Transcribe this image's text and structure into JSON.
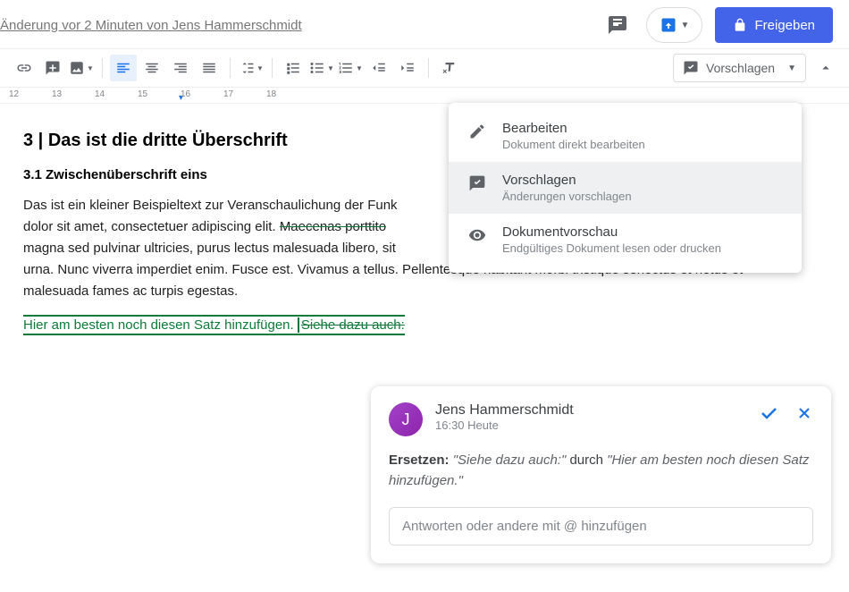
{
  "topbar": {
    "history": "Änderung vor 2 Minuten von Jens Hammerschmidt",
    "share_label": "Freigeben"
  },
  "toolbar": {
    "mode_label": "Vorschlagen"
  },
  "ruler": {
    "ticks": [
      "12",
      "13",
      "14",
      "15",
      "16",
      "17",
      "18"
    ]
  },
  "doc": {
    "h3": "3 | Das ist die dritte Überschrift",
    "h4": "3.1 Zwischenüberschrift eins",
    "p1_a": "Das ist ein kleiner Beispieltext zur Veranschaulichung der Funk",
    "p1_b": "dolor sit amet, consectetuer adipiscing elit. ",
    "p1_strike": "Maecenas porttito",
    "p1_c": "magna sed pulvinar ultricies, purus lectus malesuada libero, sit",
    "p1_d": "urna. Nunc viverra imperdiet enim. Fusce est. Vivamus a tellus. Pellentesque habitant morbi tristique senectus et netus et malesuada fames ac turpis egestas.",
    "suggest_add": "Hier am besten noch diesen Satz hinzufügen. ",
    "suggest_del": "Siehe dazu auch:"
  },
  "mode_menu": {
    "items": [
      {
        "title": "Bearbeiten",
        "sub": "Dokument direkt bearbeiten"
      },
      {
        "title": "Vorschlagen",
        "sub": "Änderungen vorschlagen"
      },
      {
        "title": "Dokumentvorschau",
        "sub": "Endgültiges Dokument lesen oder drucken"
      }
    ]
  },
  "card": {
    "avatar_initial": "J",
    "author": "Jens Hammerschmidt",
    "time": "16:30 Heute",
    "action_label": "Ersetzen:",
    "old_text": "\"Siehe dazu auch:\"",
    "connector": " durch ",
    "new_text": "\"Hier am besten noch diesen Satz hinzufügen.\"",
    "reply_placeholder": "Antworten oder andere mit @ hinzufügen"
  }
}
